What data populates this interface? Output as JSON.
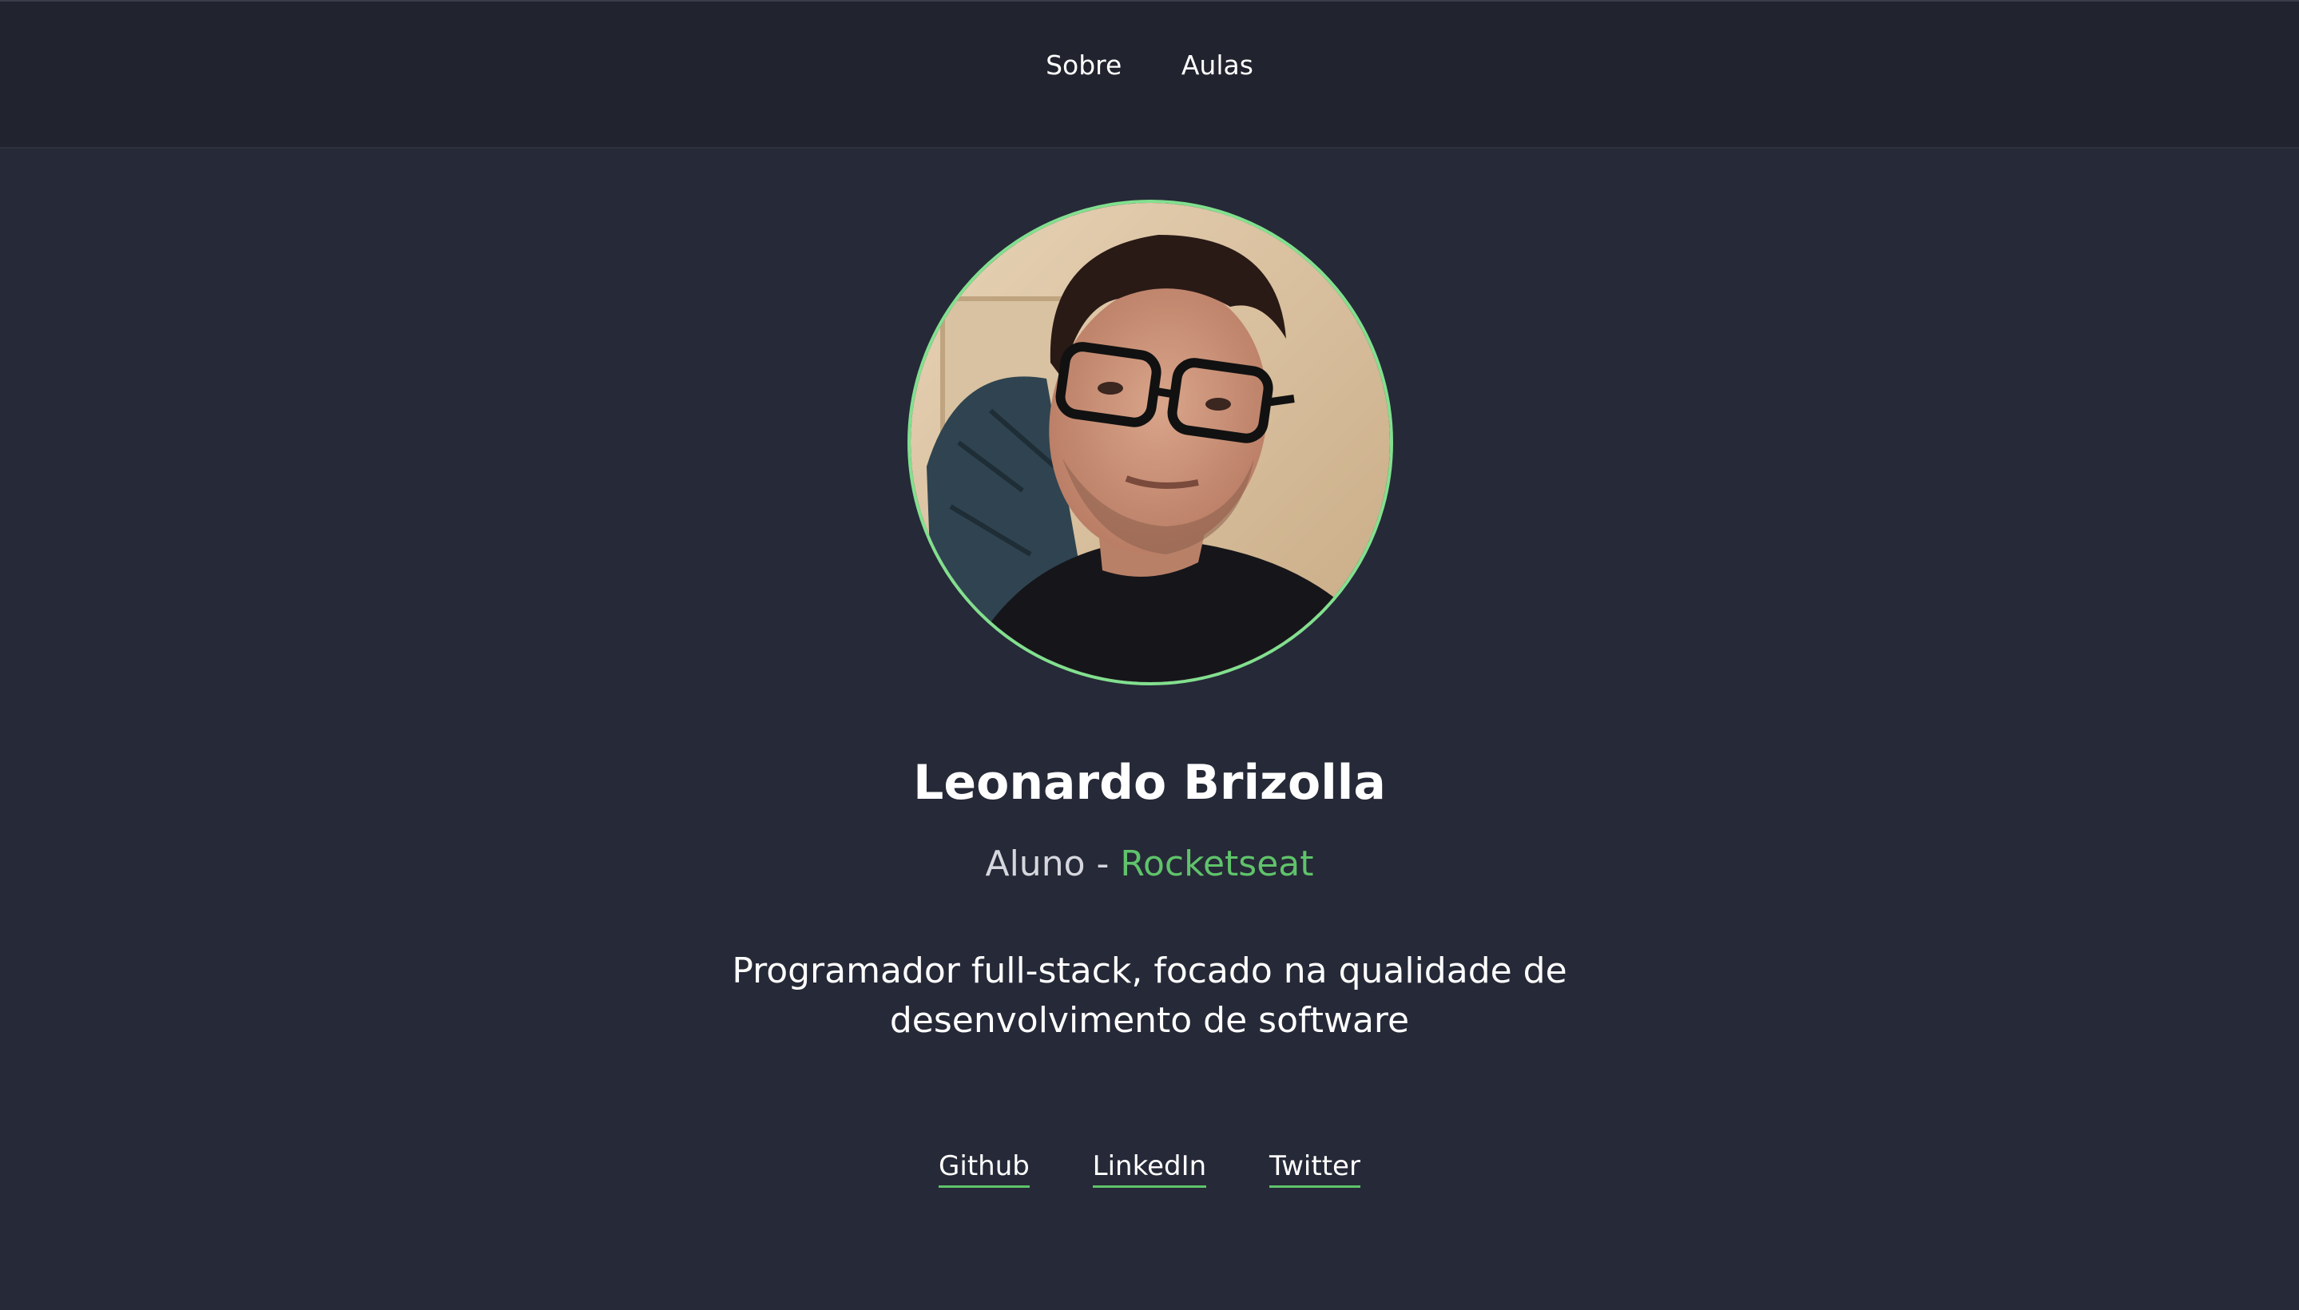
{
  "nav": {
    "items": [
      {
        "label": "Sobre"
      },
      {
        "label": "Aulas"
      }
    ]
  },
  "profile": {
    "name": "Leonardo Brizolla",
    "role_prefix": "Aluno - ",
    "company": "Rocketseat",
    "bio": "Programador full-stack, focado na qualidade de desenvolvimento de software",
    "avatar_border_color": "#82e08f"
  },
  "links": [
    {
      "label": "Github"
    },
    {
      "label": "LinkedIn"
    },
    {
      "label": "Twitter"
    }
  ],
  "colors": {
    "background": "#262937",
    "header": "#21232e",
    "accent": "#5fc36b"
  }
}
